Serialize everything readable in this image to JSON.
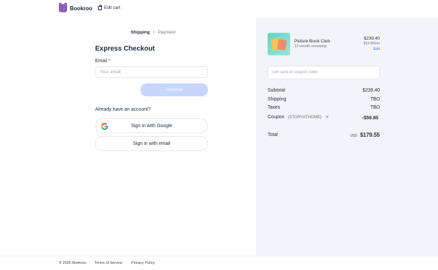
{
  "header": {
    "brand": "Bookroo",
    "edit_cart": "Edit cart"
  },
  "breadcrumb": {
    "steps": [
      "Shipping",
      "Payment"
    ],
    "separator": ">"
  },
  "form": {
    "title": "Express Checkout",
    "email_label": "Email",
    "required_mark": "*",
    "email_value": "",
    "email_placeholder": "Your email",
    "continue_label": "Continue",
    "have_account": "Already have an account?",
    "google_label": "Sign in with Google",
    "email_signin_label": "Sign in with email"
  },
  "order": {
    "product": {
      "name": "Picture Book Club",
      "subtitle": "12-month renewing",
      "price": "$239.40",
      "price_sub": "$19.95/mo",
      "edit": "Edit"
    },
    "coupon_placeholder": "Gift card or coupon code",
    "subtotal_label": "Subtotal",
    "subtotal_value": "$239.40",
    "shipping_label": "Shipping",
    "shipping_value": "TBD",
    "taxes_label": "Taxes",
    "taxes_value": "TBD",
    "coupon_label": "Coupon",
    "coupon_code": "(STORYATHOME)",
    "coupon_value": "-$59.85",
    "total_label": "Total",
    "currency": "USD",
    "total_value": "$179.55"
  },
  "footer": {
    "copyright": "© 2025 Bookroo",
    "terms": "Terms of Service",
    "privacy": "Privacy Policy"
  },
  "colors": {
    "accent": "#4f6bd8",
    "button_disabled": "#c7d6fb",
    "panel_bg": "#f3f4f8",
    "brand": "#8b5fbf"
  }
}
